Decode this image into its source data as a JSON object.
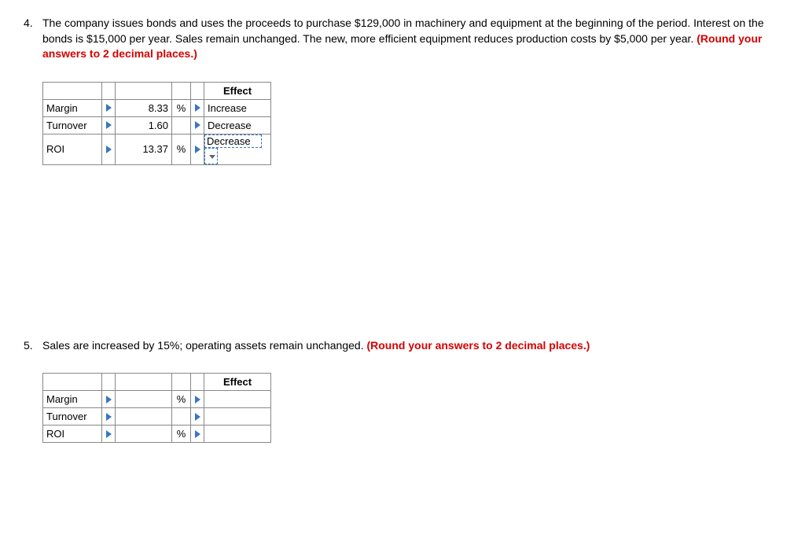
{
  "question4": {
    "number": "4.",
    "text_part1": "The company issues bonds and uses the proceeds to purchase $129,000 in machinery and equipment at the beginning of the period. Interest on the bonds is $15,000 per year. Sales remain unchanged. The new, more efficient equipment reduces production costs by $5,000 per year. ",
    "note": "(Round your answers to 2 decimal places.)",
    "effect_header": "Effect",
    "rows": [
      {
        "label": "Margin",
        "value": "8.33",
        "pct": "%",
        "effect": "Increase"
      },
      {
        "label": "Turnover",
        "value": "1.60",
        "pct": "",
        "effect": "Decrease"
      },
      {
        "label": "ROI",
        "value": "13.37",
        "pct": "%",
        "effect": "Decrease"
      }
    ]
  },
  "question5": {
    "number": "5.",
    "text_part1": "Sales are increased by 15%; operating assets remain unchanged. ",
    "note": "(Round your answers to 2 decimal places.)",
    "effect_header": "Effect",
    "rows": [
      {
        "label": "Margin",
        "value": "",
        "pct": "%",
        "effect": ""
      },
      {
        "label": "Turnover",
        "value": "",
        "pct": "",
        "effect": ""
      },
      {
        "label": "ROI",
        "value": "",
        "pct": "%",
        "effect": ""
      }
    ]
  }
}
